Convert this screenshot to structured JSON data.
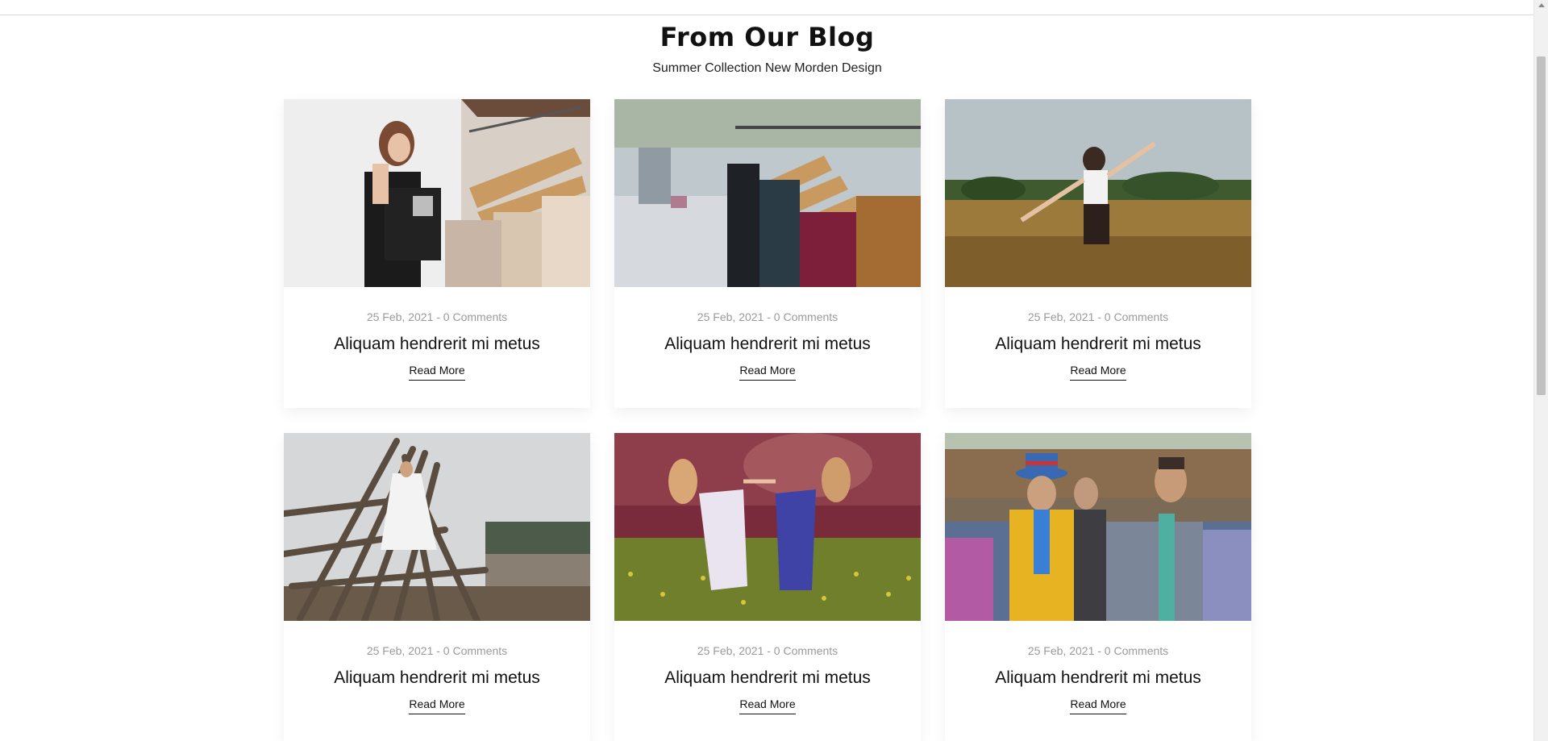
{
  "section": {
    "title": "From Our Blog",
    "subtitle": "Summer Collection New Morden Design"
  },
  "posts": [
    {
      "meta": "25 Feb, 2021 - 0 Comments",
      "title": "Aliquam hendrerit mi metus",
      "link": "Read More",
      "image": "woman-shopping-clothes-rack"
    },
    {
      "meta": "25 Feb, 2021 - 0 Comments",
      "title": "Aliquam hendrerit mi metus",
      "link": "Read More",
      "image": "clothes-on-hangers"
    },
    {
      "meta": "25 Feb, 2021 - 0 Comments",
      "title": "Aliquam hendrerit mi metus",
      "link": "Read More",
      "image": "woman-dancing-in-field"
    },
    {
      "meta": "25 Feb, 2021 - 0 Comments",
      "title": "Aliquam hendrerit mi metus",
      "link": "Read More",
      "image": "bride-on-wooden-structure"
    },
    {
      "meta": "25 Feb, 2021 - 0 Comments",
      "title": "Aliquam hendrerit mi metus",
      "link": "Read More",
      "image": "two-women-in-meadow"
    },
    {
      "meta": "25 Feb, 2021 - 0 Comments",
      "title": "Aliquam hendrerit mi metus",
      "link": "Read More",
      "image": "men-in-suits-street"
    }
  ],
  "colors": {
    "text": "#111111",
    "meta": "#9a9a9a",
    "border": "#d9d9d9"
  }
}
